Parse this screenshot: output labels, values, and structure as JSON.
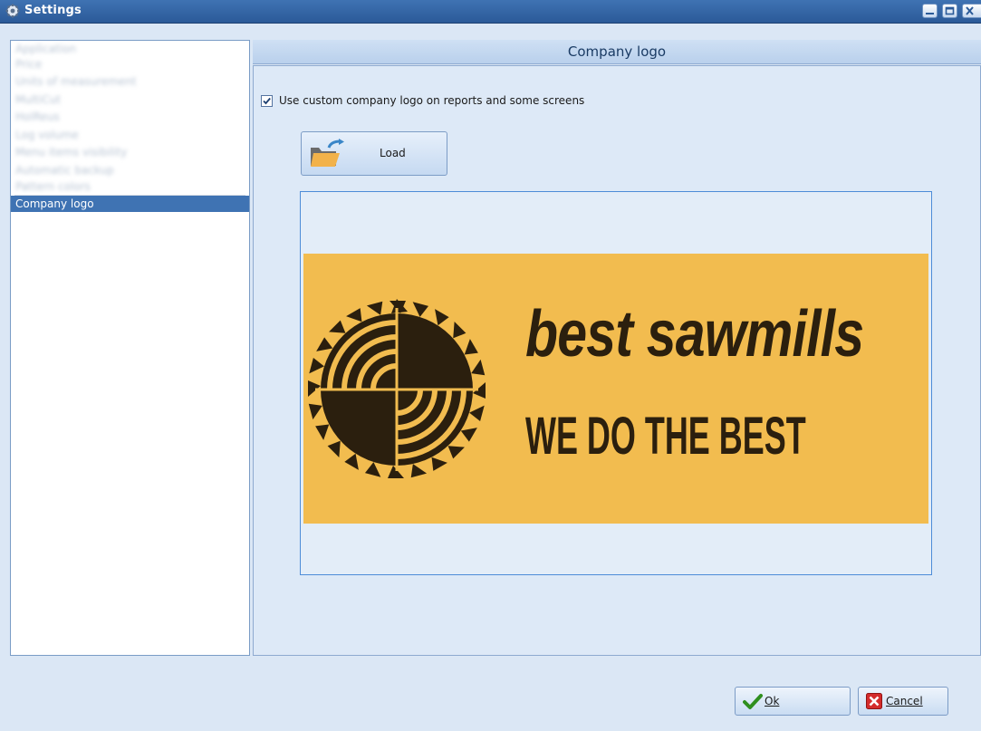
{
  "window": {
    "title": "Settings",
    "icon": "gear-icon"
  },
  "sidebar": {
    "items": [
      {
        "label": "Application",
        "blurred": true
      },
      {
        "label": "Price",
        "blurred": true
      },
      {
        "label": "Units of measurement",
        "blurred": true
      },
      {
        "label": "MultiCut",
        "blurred": true
      },
      {
        "label": "HolReus",
        "blurred": true
      },
      {
        "label": "Log volume",
        "blurred": true
      },
      {
        "label": "Menu items visibility",
        "blurred": true
      },
      {
        "label": "Automatic backup",
        "blurred": true
      },
      {
        "label": "Pattern colors",
        "blurred": true
      },
      {
        "label": "Company logo",
        "selected": true
      }
    ]
  },
  "main": {
    "header": "Company logo",
    "checkbox": {
      "label": "Use custom company logo on reports and some screens",
      "checked": true
    },
    "load_button": {
      "label": "Load",
      "icon": "folder-open-icon"
    },
    "logo_image": {
      "brand": "best sawmills",
      "tagline": "WE DO THE BEST",
      "background": "#f2bc4f",
      "ink": "#2b1f0e"
    }
  },
  "footer": {
    "ok_label": "Ok",
    "cancel_label": "Cancel"
  }
}
